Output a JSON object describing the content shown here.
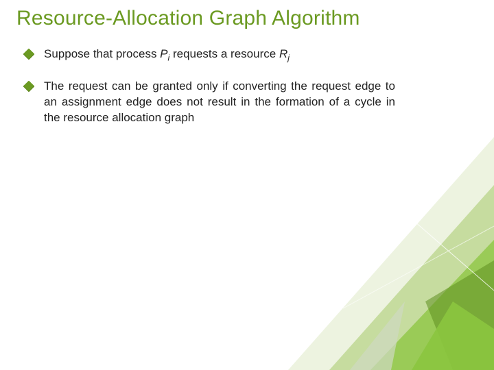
{
  "title": "Resource-Allocation Graph Algorithm",
  "bullets": [
    {
      "pre": "Suppose that process ",
      "var1": "P",
      "sub1": "i",
      "mid": " requests a resource ",
      "var2": "R",
      "sub2": "j",
      "post": ""
    },
    {
      "text": "The request can be granted only if converting the request edge to an assignment edge does not result in the formation of a cycle in the resource allocation graph"
    }
  ]
}
